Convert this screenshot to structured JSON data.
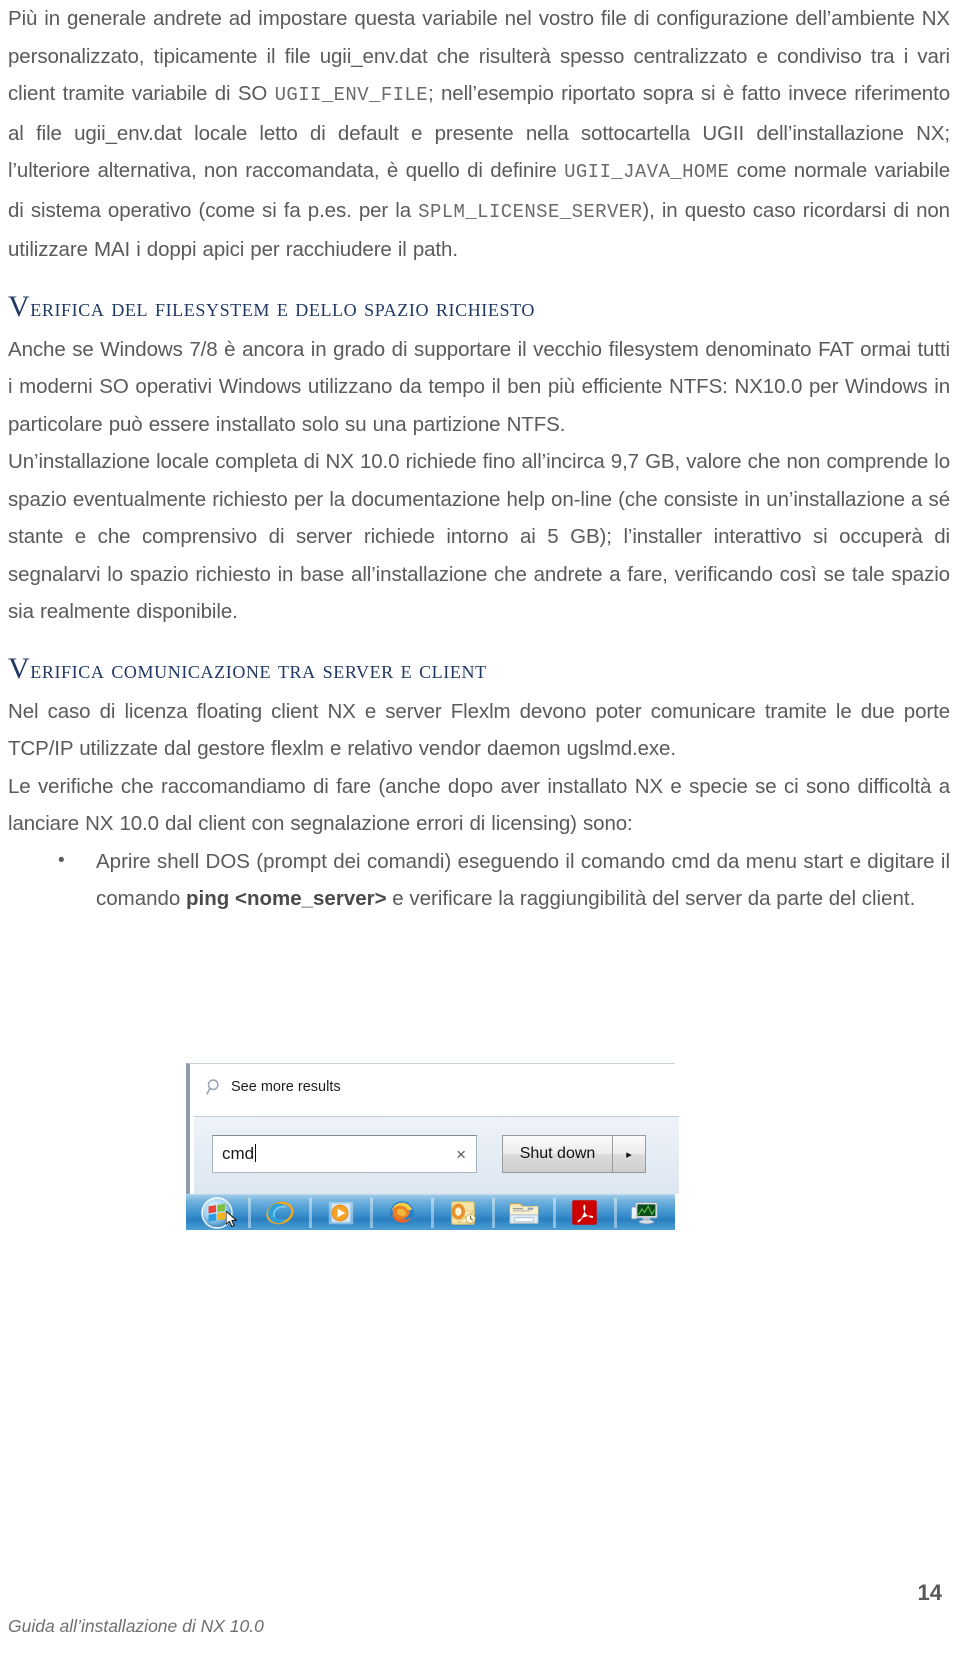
{
  "document": {
    "page_number": "14",
    "footer_title": "Guida all’installazione di NX 10.0"
  },
  "paragraphs": {
    "p1_part1": "Più in generale andrete ad impostare questa variabile nel vostro file di configurazione dell’ambiente NX personalizzato, tipicamente il file ugii_env.dat che risulterà spesso centralizzato e condiviso tra i vari client tramite variabile di SO ",
    "p1_code1": "UGII_ENV_FILE",
    "p1_part2": "; nell’esempio riportato sopra si è fatto invece riferimento al file ugii_env.dat locale letto di default e presente nella sottocartella UGII dell’installazione NX; l’ulteriore alternativa, non raccomandata, è quello di definire ",
    "p1_code2": "UGII_JAVA_HOME",
    "p1_part3": " come normale variabile di sistema operativo (come si fa p.es. per la ",
    "p1_code3": "SPLM_LICENSE_SERVER",
    "p1_part4": "), in questo caso ricordarsi di non utilizzare MAI i doppi apici per racchiudere il path."
  },
  "section1": {
    "heading_first_letter": "V",
    "heading_rest": "erifica del filesystem e dello spazio richiesto",
    "heading_full": "Verifica del filesystem e dello spazio richiesto",
    "p1": "Anche se Windows 7/8 è ancora in grado di supportare il vecchio filesystem denominato FAT ormai tutti i moderni SO operativi Windows utilizzano da tempo il ben più efficiente NTFS: NX10.0 per Windows in particolare può essere installato solo su una partizione NTFS.",
    "p2": "Un’installazione locale completa di NX 10.0 richiede fino all’incirca 9,7 GB, valore che non comprende lo spazio eventualmente richiesto per la documentazione help on-line (che consiste in un’installazione a sé stante e che comprensivo di server richiede intorno ai 5 GB); l’installer interattivo si occuperà di segnalarvi lo spazio richiesto in base all’installazione che andrete a fare, verificando così se tale spazio sia realmente disponibile."
  },
  "section2": {
    "heading_first_letter": "V",
    "heading_rest": "erifica comunicazione tra server e client",
    "heading_full": "Verifica comunicazione tra server e client",
    "p1": "Nel caso di licenza floating client NX e server Flexlm devono poter comunicare tramite le due porte TCP/IP utilizzate dal gestore flexlm e relativo vendor daemon ugslmd.exe.",
    "p2": "Le verifiche che raccomandiamo di fare (anche dopo aver installato NX e specie se ci sono difficoltà a lanciare NX 10.0 dal client con segnalazione errori di licensing) sono:",
    "bullet1_part1": "Aprire shell DOS (prompt dei comandi) eseguendo il comando cmd da menu start e digitare il comando ",
    "bullet1_bold": "ping <nome_server>",
    "bullet1_part2": " e verificare la raggiungibilità del server da parte del client."
  },
  "screenshot": {
    "see_more_results_label": "See more results",
    "search_value": "cmd",
    "search_clear_label": "×",
    "shutdown_label": "Shut down",
    "shutdown_arrow_label": "▸",
    "taskbar_items": [
      {
        "name": "start-orb-icon",
        "label": "Start"
      },
      {
        "name": "internet-explorer-icon",
        "label": "Internet Explorer"
      },
      {
        "name": "windows-media-player-icon",
        "label": "Windows Media Player"
      },
      {
        "name": "firefox-icon",
        "label": "Mozilla Firefox"
      },
      {
        "name": "outlook-icon",
        "label": "Microsoft Outlook"
      },
      {
        "name": "windows-explorer-folder-icon",
        "label": "Windows Explorer"
      },
      {
        "name": "adobe-acrobat-icon",
        "label": "Adobe Acrobat"
      },
      {
        "name": "computer-monitor-icon",
        "label": "Computer"
      }
    ]
  },
  "colors": {
    "heading": "#1f3864",
    "body_text": "#5a5a5a",
    "taskbar_blue": "#3f93cf",
    "acrobat_red": "#cc0000"
  }
}
